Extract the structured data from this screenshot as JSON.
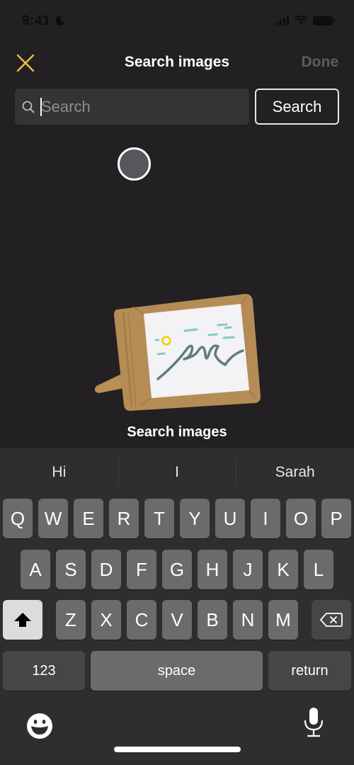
{
  "status_bar": {
    "time": "9:41",
    "focus_icon": "moon-icon"
  },
  "nav": {
    "title": "Search images",
    "close_icon": "close-icon",
    "done_label": "Done"
  },
  "search": {
    "placeholder": "Search",
    "value": "",
    "button_label": "Search"
  },
  "empty_state": {
    "title": "Search images",
    "illustration": "picture-frame-illustration"
  },
  "keyboard": {
    "suggestions": [
      "Hi",
      "I",
      "Sarah"
    ],
    "row1": [
      "Q",
      "W",
      "E",
      "R",
      "T",
      "Y",
      "U",
      "I",
      "O",
      "P"
    ],
    "row2": [
      "A",
      "S",
      "D",
      "F",
      "G",
      "H",
      "J",
      "K",
      "L"
    ],
    "row3": [
      "Z",
      "X",
      "C",
      "V",
      "B",
      "N",
      "M"
    ],
    "numbers_label": "123",
    "space_label": "space",
    "return_label": "return"
  },
  "colors": {
    "accent": "#f2c13b",
    "background": "#222023",
    "keyboard": "#2e2d30",
    "done_disabled": "#5e5c60"
  }
}
